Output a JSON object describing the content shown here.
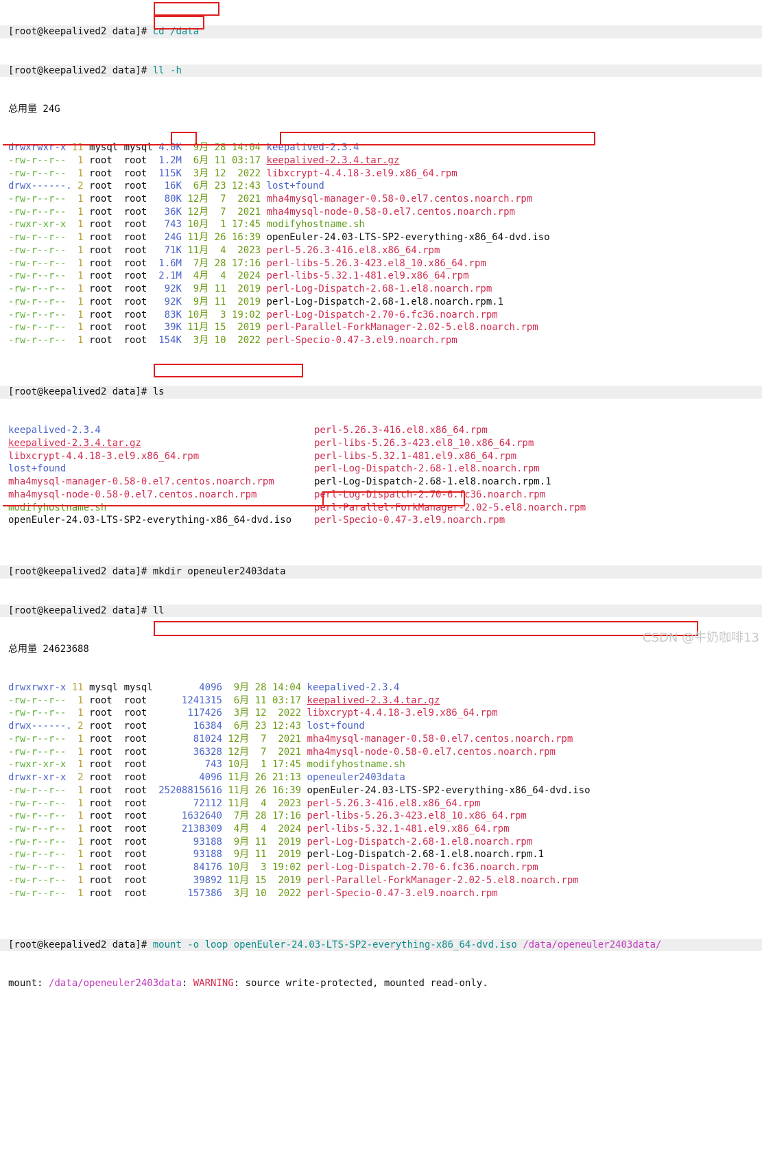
{
  "prompt": "[root@keepalived2 data]#",
  "cmd1": "cd /data",
  "cmd2": "ll -h",
  "total1": "总用量 24G",
  "list1": [
    {
      "perm": "drwxrwxr-x",
      "links": " 11",
      "user": "mysql",
      "group": "mysql",
      "size": " 4.0K",
      "date": " 9月 28 14:04",
      "name": "keepalived-2.3.4",
      "kind": "dir"
    },
    {
      "perm": "-rw-r--r--",
      "links": "  1",
      "user": "root ",
      "group": "root ",
      "size": " 1.2M",
      "date": " 6月 11 03:17",
      "name": "keepalived-2.3.4.tar.gz",
      "kind": "tgz"
    },
    {
      "perm": "-rw-r--r--",
      "links": "  1",
      "user": "root ",
      "group": "root ",
      "size": " 115K",
      "date": " 3月 12  2022",
      "name": "libxcrypt-4.4.18-3.el9.x86_64.rpm",
      "kind": "rpm"
    },
    {
      "perm": "drwx------.",
      "links": " 2",
      "user": "root ",
      "group": "root ",
      "size": "  16K",
      "date": " 6月 23 12:43",
      "name": "lost+found",
      "kind": "dir"
    },
    {
      "perm": "-rw-r--r--",
      "links": "  1",
      "user": "root ",
      "group": "root ",
      "size": "  80K",
      "date": "12月  7  2021",
      "name": "mha4mysql-manager-0.58-0.el7.centos.noarch.rpm",
      "kind": "rpm"
    },
    {
      "perm": "-rw-r--r--",
      "links": "  1",
      "user": "root ",
      "group": "root ",
      "size": "  36K",
      "date": "12月  7  2021",
      "name": "mha4mysql-node-0.58-0.el7.centos.noarch.rpm",
      "kind": "rpm"
    },
    {
      "perm": "-rwxr-xr-x",
      "links": "  1",
      "user": "root ",
      "group": "root ",
      "size": "  743",
      "date": "10月  1 17:45",
      "name": "modifyhostname.sh",
      "kind": "exe"
    },
    {
      "perm": "-rw-r--r--",
      "links": "  1",
      "user": "root ",
      "group": "root ",
      "size": "  24G",
      "date": "11月 26 16:39",
      "name": "openEuler-24.03-LTS-SP2-everything-x86_64-dvd.iso",
      "kind": "iso"
    },
    {
      "perm": "-rw-r--r--",
      "links": "  1",
      "user": "root ",
      "group": "root ",
      "size": "  71K",
      "date": "11月  4  2023",
      "name": "perl-5.26.3-416.el8.x86_64.rpm",
      "kind": "rpm"
    },
    {
      "perm": "-rw-r--r--",
      "links": "  1",
      "user": "root ",
      "group": "root ",
      "size": " 1.6M",
      "date": " 7月 28 17:16",
      "name": "perl-libs-5.26.3-423.el8_10.x86_64.rpm",
      "kind": "rpm"
    },
    {
      "perm": "-rw-r--r--",
      "links": "  1",
      "user": "root ",
      "group": "root ",
      "size": " 2.1M",
      "date": " 4月  4  2024",
      "name": "perl-libs-5.32.1-481.el9.x86_64.rpm",
      "kind": "rpm"
    },
    {
      "perm": "-rw-r--r--",
      "links": "  1",
      "user": "root ",
      "group": "root ",
      "size": "  92K",
      "date": " 9月 11  2019",
      "name": "perl-Log-Dispatch-2.68-1.el8.noarch.rpm",
      "kind": "rpm"
    },
    {
      "perm": "-rw-r--r--",
      "links": "  1",
      "user": "root ",
      "group": "root ",
      "size": "  92K",
      "date": " 9月 11  2019",
      "name": "perl-Log-Dispatch-2.68-1.el8.noarch.rpm.1",
      "kind": "plain"
    },
    {
      "perm": "-rw-r--r--",
      "links": "  1",
      "user": "root ",
      "group": "root ",
      "size": "  83K",
      "date": "10月  3 19:02",
      "name": "perl-Log-Dispatch-2.70-6.fc36.noarch.rpm",
      "kind": "rpm"
    },
    {
      "perm": "-rw-r--r--",
      "links": "  1",
      "user": "root ",
      "group": "root ",
      "size": "  39K",
      "date": "11月 15  2019",
      "name": "perl-Parallel-ForkManager-2.02-5.el8.noarch.rpm",
      "kind": "rpm"
    },
    {
      "perm": "-rw-r--r--",
      "links": "  1",
      "user": "root ",
      "group": "root ",
      "size": " 154K",
      "date": " 3月 10  2022",
      "name": "perl-Specio-0.47-3.el9.noarch.rpm",
      "kind": "rpm"
    }
  ],
  "cmd3": "ls",
  "ls_left": [
    {
      "name": "keepalived-2.3.4",
      "kind": "dir"
    },
    {
      "name": "keepalived-2.3.4.tar.gz",
      "kind": "tgz"
    },
    {
      "name": "libxcrypt-4.4.18-3.el9.x86_64.rpm",
      "kind": "rpm"
    },
    {
      "name": "lost+found",
      "kind": "dir"
    },
    {
      "name": "mha4mysql-manager-0.58-0.el7.centos.noarch.rpm",
      "kind": "rpm"
    },
    {
      "name": "mha4mysql-node-0.58-0.el7.centos.noarch.rpm",
      "kind": "rpm"
    },
    {
      "name": "modifyhostname.sh",
      "kind": "exe"
    },
    {
      "name": "openEuler-24.03-LTS-SP2-everything-x86_64-dvd.iso",
      "kind": "iso"
    }
  ],
  "ls_right": [
    {
      "name": "perl-5.26.3-416.el8.x86_64.rpm",
      "kind": "rpm"
    },
    {
      "name": "perl-libs-5.26.3-423.el8_10.x86_64.rpm",
      "kind": "rpm"
    },
    {
      "name": "perl-libs-5.32.1-481.el9.x86_64.rpm",
      "kind": "rpm"
    },
    {
      "name": "perl-Log-Dispatch-2.68-1.el8.noarch.rpm",
      "kind": "rpm"
    },
    {
      "name": "perl-Log-Dispatch-2.68-1.el8.noarch.rpm.1",
      "kind": "plain"
    },
    {
      "name": "perl-Log-Dispatch-2.70-6.fc36.noarch.rpm",
      "kind": "rpm"
    },
    {
      "name": "perl-Parallel-ForkManager-2.02-5.el8.noarch.rpm",
      "kind": "rpm"
    },
    {
      "name": "perl-Specio-0.47-3.el9.noarch.rpm",
      "kind": "rpm"
    }
  ],
  "cmd4": "mkdir openeuler2403data",
  "cmd5": "ll",
  "total2": "总用量 24623688",
  "list2": [
    {
      "perm": "drwxrwxr-x",
      "links": " 11",
      "user": "mysql",
      "group": "mysql",
      "size": "        4096",
      "date": " 9月 28 14:04",
      "name": "keepalived-2.3.4",
      "kind": "dir"
    },
    {
      "perm": "-rw-r--r--",
      "links": "  1",
      "user": "root ",
      "group": "root ",
      "size": "     1241315",
      "date": " 6月 11 03:17",
      "name": "keepalived-2.3.4.tar.gz",
      "kind": "tgz"
    },
    {
      "perm": "-rw-r--r--",
      "links": "  1",
      "user": "root ",
      "group": "root ",
      "size": "      117426",
      "date": " 3月 12  2022",
      "name": "libxcrypt-4.4.18-3.el9.x86_64.rpm",
      "kind": "rpm"
    },
    {
      "perm": "drwx------.",
      "links": " 2",
      "user": "root ",
      "group": "root ",
      "size": "       16384",
      "date": " 6月 23 12:43",
      "name": "lost+found",
      "kind": "dir"
    },
    {
      "perm": "-rw-r--r--",
      "links": "  1",
      "user": "root ",
      "group": "root ",
      "size": "       81024",
      "date": "12月  7  2021",
      "name": "mha4mysql-manager-0.58-0.el7.centos.noarch.rpm",
      "kind": "rpm"
    },
    {
      "perm": "-rw-r--r--",
      "links": "  1",
      "user": "root ",
      "group": "root ",
      "size": "       36328",
      "date": "12月  7  2021",
      "name": "mha4mysql-node-0.58-0.el7.centos.noarch.rpm",
      "kind": "rpm"
    },
    {
      "perm": "-rwxr-xr-x",
      "links": "  1",
      "user": "root ",
      "group": "root ",
      "size": "         743",
      "date": "10月  1 17:45",
      "name": "modifyhostname.sh",
      "kind": "exe"
    },
    {
      "perm": "drwxr-xr-x",
      "links": "  2",
      "user": "root ",
      "group": "root ",
      "size": "        4096",
      "date": "11月 26 21:13",
      "name": "openeuler2403data",
      "kind": "dir"
    },
    {
      "perm": "-rw-r--r--",
      "links": "  1",
      "user": "root ",
      "group": "root ",
      "size": " 25208815616",
      "date": "11月 26 16:39",
      "name": "openEuler-24.03-LTS-SP2-everything-x86_64-dvd.iso",
      "kind": "iso"
    },
    {
      "perm": "-rw-r--r--",
      "links": "  1",
      "user": "root ",
      "group": "root ",
      "size": "       72112",
      "date": "11月  4  2023",
      "name": "perl-5.26.3-416.el8.x86_64.rpm",
      "kind": "rpm"
    },
    {
      "perm": "-rw-r--r--",
      "links": "  1",
      "user": "root ",
      "group": "root ",
      "size": "     1632640",
      "date": " 7月 28 17:16",
      "name": "perl-libs-5.26.3-423.el8_10.x86_64.rpm",
      "kind": "rpm"
    },
    {
      "perm": "-rw-r--r--",
      "links": "  1",
      "user": "root ",
      "group": "root ",
      "size": "     2138309",
      "date": " 4月  4  2024",
      "name": "perl-libs-5.32.1-481.el9.x86_64.rpm",
      "kind": "rpm"
    },
    {
      "perm": "-rw-r--r--",
      "links": "  1",
      "user": "root ",
      "group": "root ",
      "size": "       93188",
      "date": " 9月 11  2019",
      "name": "perl-Log-Dispatch-2.68-1.el8.noarch.rpm",
      "kind": "rpm"
    },
    {
      "perm": "-rw-r--r--",
      "links": "  1",
      "user": "root ",
      "group": "root ",
      "size": "       93188",
      "date": " 9月 11  2019",
      "name": "perl-Log-Dispatch-2.68-1.el8.noarch.rpm.1",
      "kind": "plain"
    },
    {
      "perm": "-rw-r--r--",
      "links": "  1",
      "user": "root ",
      "group": "root ",
      "size": "       84176",
      "date": "10月  3 19:02",
      "name": "perl-Log-Dispatch-2.70-6.fc36.noarch.rpm",
      "kind": "rpm"
    },
    {
      "perm": "-rw-r--r--",
      "links": "  1",
      "user": "root ",
      "group": "root ",
      "size": "       39892",
      "date": "11月 15  2019",
      "name": "perl-Parallel-ForkManager-2.02-5.el8.noarch.rpm",
      "kind": "rpm"
    },
    {
      "perm": "-rw-r--r--",
      "links": "  1",
      "user": "root ",
      "group": "root ",
      "size": "      157386",
      "date": " 3月 10  2022",
      "name": "perl-Specio-0.47-3.el9.noarch.rpm",
      "kind": "rpm"
    }
  ],
  "cmd6_head": "mount -o loop openEuler-24.03-LTS-SP2-everything-x86_64-dvd.iso",
  "cmd6_path": "/data/openeuler2403data/",
  "mount_msg_prefix": "mount: ",
  "mount_msg_path": "/data/openeuler2403data",
  "mount_msg_sep": ": ",
  "mount_msg_warn": "WARNING",
  "mount_msg_rest": ": source write-protected, mounted read-only.",
  "watermark": "CSDN @牛奶咖啡13",
  "colors": {
    "highlight": "#e01d1d",
    "dir": "#4b63c9",
    "rpm": "#d12e50",
    "exe": "#5f9a1a"
  }
}
